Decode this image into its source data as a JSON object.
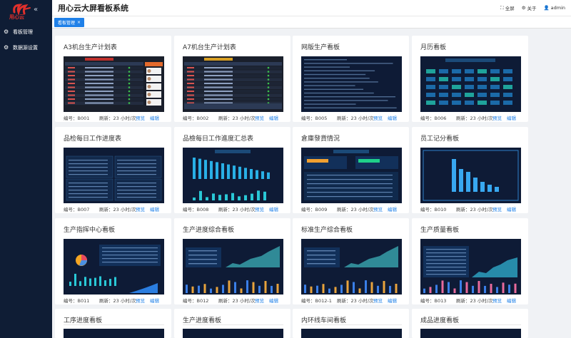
{
  "app": {
    "logo_text": "用心云",
    "title": "用心云大屏看板系统",
    "collapse_glyph": "«"
  },
  "sidebar": {
    "items": [
      {
        "label": "看板管理",
        "icon": "gear-icon"
      },
      {
        "label": "数据源设置",
        "icon": "gear-icon"
      }
    ]
  },
  "header": {
    "fullscreen": "全屏",
    "about": "关于",
    "user": "admin"
  },
  "tabs": [
    {
      "label": "看板管理",
      "close": "×"
    }
  ],
  "actions": {
    "preview": "预览",
    "edit": "编辑"
  },
  "cards": [
    {
      "title": "A3机台生产计划表",
      "code": "编号：B001",
      "refresh": "刷新：23 小时/次",
      "kind": "table-red"
    },
    {
      "title": "A7机台生产计划表",
      "code": "编号：B002",
      "refresh": "刷新：23 小时/次",
      "kind": "table-dark"
    },
    {
      "title": "网版生产看板",
      "code": "编号：B005",
      "refresh": "刷新：23 小时/次",
      "kind": "list"
    },
    {
      "title": "月历看板",
      "code": "编号：B006",
      "refresh": "刷新：23 小时/次",
      "kind": "calendar"
    },
    {
      "title": "品检每日工作进度表",
      "code": "编号：B007",
      "refresh": "刷新：23 小时/次",
      "kind": "grid4"
    },
    {
      "title": "品檢每日工作進度汇总表",
      "code": "编号：B008",
      "refresh": "刷新：23 小时/次",
      "kind": "bars"
    },
    {
      "title": "倉庫發貨情況",
      "code": "编号：B009",
      "refresh": "刷新：23 小时/次",
      "kind": "warehouse"
    },
    {
      "title": "员工记分看板",
      "code": "编号：B010",
      "refresh": "刷新：23 小时/次",
      "kind": "score"
    },
    {
      "title": "生产指挥中心看板",
      "code": "编号：B011",
      "refresh": "刷新：23 小时/次",
      "kind": "command"
    },
    {
      "title": "生产进度综合看板",
      "code": "编号：B012",
      "refresh": "刷新：23 小时/次",
      "kind": "dash"
    },
    {
      "title": "标准生产综合看板",
      "code": "编号：B012-1",
      "refresh": "刷新：23 小时/次",
      "kind": "dash"
    },
    {
      "title": "生产质量看板",
      "code": "编号：B013",
      "refresh": "刷新：23 小时/次",
      "kind": "quality"
    },
    {
      "title": "工序进度看板",
      "code": "",
      "refresh": "",
      "kind": "none"
    },
    {
      "title": "生产进度看板",
      "code": "",
      "refresh": "",
      "kind": "none"
    },
    {
      "title": "内环线车间看板",
      "code": "",
      "refresh": "",
      "kind": "none"
    },
    {
      "title": "成品进度看板",
      "code": "",
      "refresh": "",
      "kind": "none"
    }
  ]
}
